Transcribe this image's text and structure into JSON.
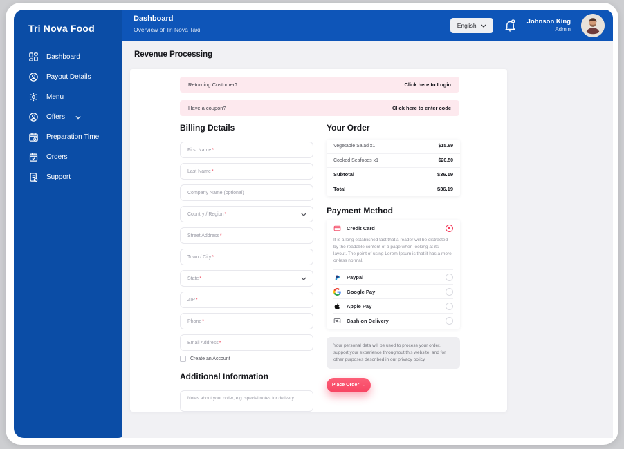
{
  "colors": {
    "sidebar_blue": "#0b4da6",
    "header_blue": "#0e55b8",
    "banner_pink": "#fde9ee",
    "accent_red": "#f74563",
    "content_gray": "#f1f1f4"
  },
  "sidebar": {
    "brand": "Tri Nova Food",
    "items": [
      {
        "label": "Dashboard",
        "icon": "dashboard-icon"
      },
      {
        "label": "Payout Details",
        "icon": "user-circle-icon"
      },
      {
        "label": "Menu",
        "icon": "gear-icon"
      },
      {
        "label": "Offers",
        "icon": "user-circle-icon",
        "has_chevron": true
      },
      {
        "label": "Preparation Time",
        "icon": "calendar-clock-icon"
      },
      {
        "label": "Orders",
        "icon": "calendar-check-icon"
      },
      {
        "label": "Support",
        "icon": "support-doc-icon"
      }
    ]
  },
  "header": {
    "title": "Dashboard",
    "subtitle": "Overview of Tri Nova Taxi",
    "language": "English",
    "user_name": "Johnson King",
    "user_role": "Admin"
  },
  "page": {
    "title": "Revenue Processing",
    "banners": [
      {
        "question": "Returning Customer?",
        "action": "Click here to Login"
      },
      {
        "question": "Have a coupon?",
        "action": "Click here to enter code"
      }
    ],
    "billing": {
      "heading": "Billing Details",
      "required_mark": "*",
      "fields": [
        {
          "placeholder": "First Name",
          "required": true
        },
        {
          "placeholder": "Last Name",
          "required": true
        },
        {
          "placeholder": "Company Name (optional)",
          "required": false
        },
        {
          "placeholder": "Country / Region",
          "required": true,
          "type": "select"
        },
        {
          "placeholder": "Street Address",
          "required": true
        },
        {
          "placeholder": "Town / City",
          "required": true
        },
        {
          "placeholder": "State",
          "required": true,
          "type": "select"
        },
        {
          "placeholder": "ZIP",
          "required": true
        },
        {
          "placeholder": "Phone",
          "required": true
        },
        {
          "placeholder": "Email Address",
          "required": true
        }
      ],
      "create_account_label": "Create an Account",
      "additional_heading": "Additional Information",
      "notes_placeholder": "Notes about your order, e.g. special notes for delivery"
    },
    "order": {
      "heading": "Your Order",
      "rows": [
        {
          "label": "Vegetable Salad x1",
          "value": "$15.69",
          "bold": false
        },
        {
          "label": "Cooked Seafoods x1",
          "value": "$20.50",
          "bold": false
        },
        {
          "label": "Subtotal",
          "value": "$36.19",
          "bold": true
        },
        {
          "label": "Total",
          "value": "$36.19",
          "bold": true
        }
      ]
    },
    "payment": {
      "heading": "Payment Method",
      "methods": [
        {
          "label": "Credit Card",
          "icon": "credit-card-icon",
          "selected": true,
          "description": "It is a long established fact that a reader will be distracted by the readable content of a page when looking at its layout. The point of using Lorem Ipsum is that it has a more-or-less normal."
        },
        {
          "label": "Paypal",
          "icon": "paypal-icon",
          "selected": false
        },
        {
          "label": "Google Pay",
          "icon": "google-pay-icon",
          "selected": false
        },
        {
          "label": "Apple Pay",
          "icon": "apple-icon",
          "selected": false
        },
        {
          "label": "Cash on Delivery",
          "icon": "cash-icon",
          "selected": false
        }
      ],
      "privacy_note": "Your personal data will be used to process your order, support your experience throughout this website, and for other purposes described in our privacy policy.",
      "place_order_label": "Place Order →"
    }
  }
}
